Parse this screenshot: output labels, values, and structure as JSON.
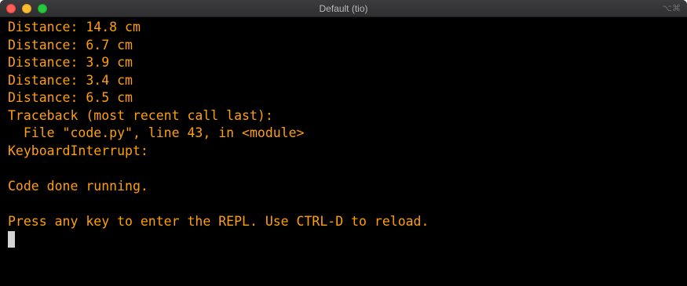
{
  "window": {
    "title": "Default (tio)",
    "shortcut": "⌥⌘"
  },
  "colors": {
    "background": "#000000",
    "text": "#ff9f0a",
    "cursor": "#d4d4d4",
    "close": "#fe5f57",
    "minimize": "#febc2e",
    "maximize": "#28c840"
  },
  "terminal": {
    "lines": [
      "Distance: 14.8 cm",
      "Distance: 6.7 cm",
      "Distance: 3.9 cm",
      "Distance: 3.4 cm",
      "Distance: 6.5 cm",
      "Traceback (most recent call last):",
      "  File \"code.py\", line 43, in <module>",
      "KeyboardInterrupt:",
      "",
      "Code done running.",
      "",
      "Press any key to enter the REPL. Use CTRL-D to reload."
    ]
  }
}
